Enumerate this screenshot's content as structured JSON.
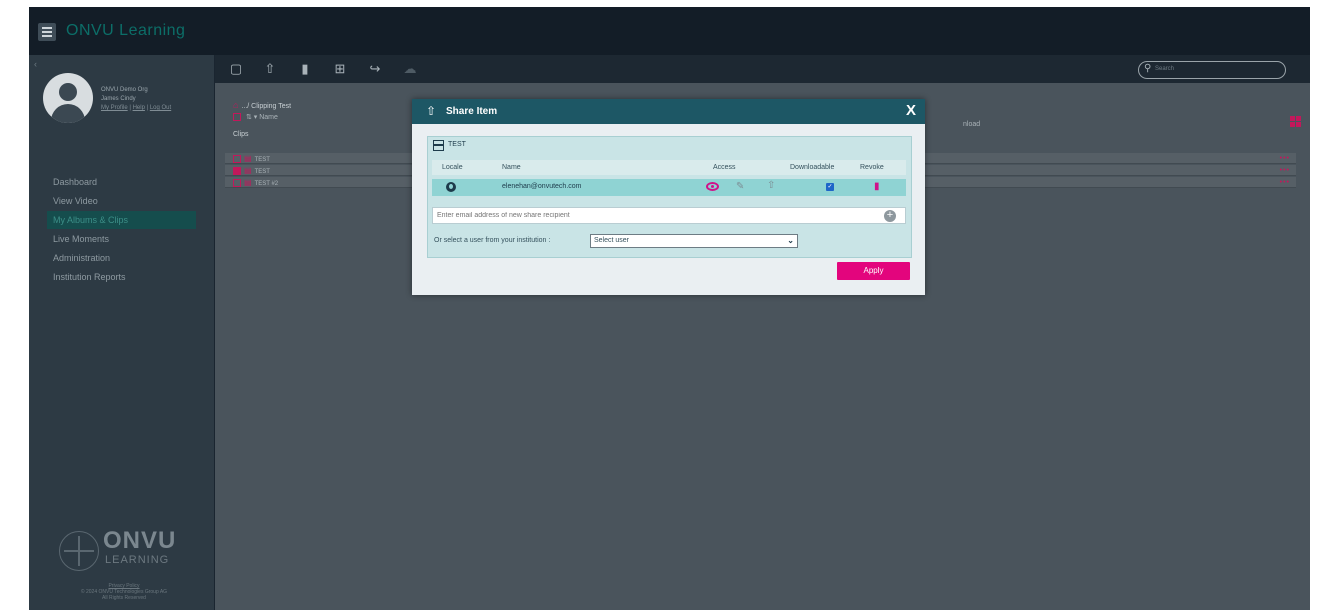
{
  "app": {
    "title": "ONVU Learning"
  },
  "sidebar": {
    "org_name": "ONVU Demo Org",
    "user_name": "James Cindy",
    "links": [
      "My Profile",
      "Help",
      "Log Out"
    ],
    "items": [
      {
        "label": "Dashboard"
      },
      {
        "label": "View Video"
      },
      {
        "label": "My Albums & Clips",
        "active": true
      },
      {
        "label": "Live Moments"
      },
      {
        "label": "Administration"
      },
      {
        "label": "Institution Reports"
      }
    ],
    "logo_word": "ONVU",
    "logo_sub": "LEARNING",
    "footer_privacy": "Privacy Policy",
    "footer_copyright": "© 2024 ONVU Technologies Group AG",
    "footer_rights": "All Rights Reserved"
  },
  "main": {
    "search_placeholder": "Search",
    "breadcrumb": ".../ Clipping Test",
    "sort_label": "Name",
    "clips_label": "Clips",
    "download_header": "nload",
    "rows": [
      {
        "name": "TEST",
        "checked": false
      },
      {
        "name": "TEST",
        "checked": true
      },
      {
        "name": "TEST #2",
        "checked": false
      }
    ],
    "row_menu": "•••"
  },
  "modal": {
    "title": "Share Item",
    "close": "X",
    "item_name": "TEST",
    "headers": {
      "locale": "Locale",
      "name": "Name",
      "access": "Access",
      "downloadable": "Downloadable",
      "revoke": "Revoke"
    },
    "share": {
      "email": "elenehan@onvutech.com",
      "downloadable": true
    },
    "email_placeholder": "Enter email address of new share recipient",
    "add_symbol": "+",
    "select_label": "Or select a user from your institution :",
    "select_value": "Select user",
    "apply_label": "Apply"
  },
  "colors": {
    "accent": "#e3057d",
    "header": "#1d5765",
    "brand": "#0c6e68"
  }
}
